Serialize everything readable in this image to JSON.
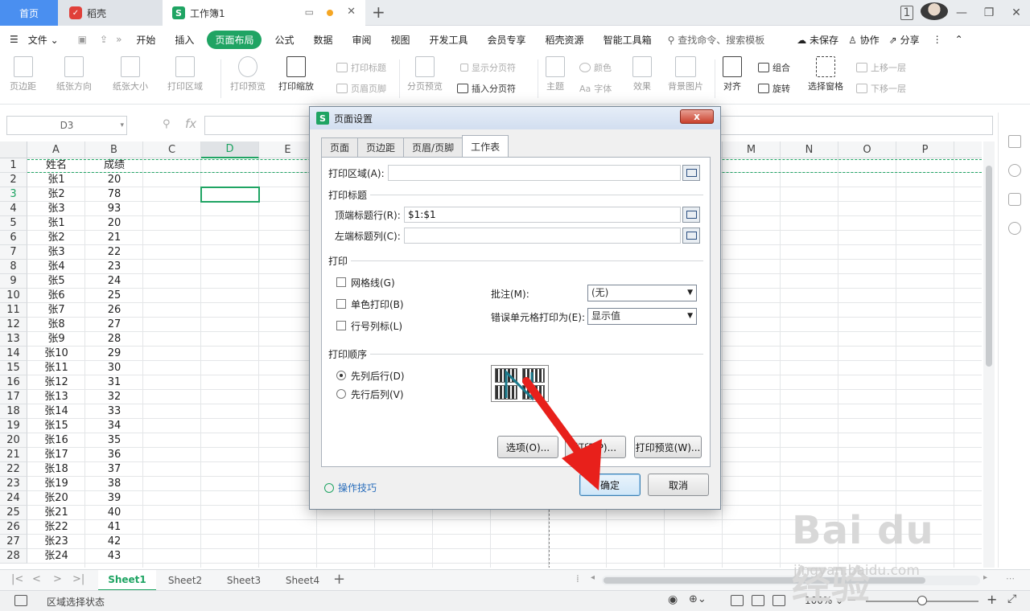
{
  "titlebar": {
    "home_tab": "首页",
    "daoke_tab": "稻壳",
    "workbook_tab": "工作簿1",
    "badge": "1"
  },
  "menubar": {
    "file": "文件",
    "items": [
      "开始",
      "插入",
      "页面布局",
      "公式",
      "数据",
      "审阅",
      "视图",
      "开发工具",
      "会员专享",
      "稻壳资源",
      "智能工具箱"
    ],
    "active": "页面布局",
    "search_placeholder": "查找命令、搜索模板",
    "unsaved": "未保存",
    "collab": "协作",
    "share": "分享"
  },
  "ribbon": {
    "margins": "页边距",
    "orientation": "纸张方向",
    "size": "纸张大小",
    "print_area": "打印区域",
    "print_preview": "打印预览",
    "print_scale": "打印缩放",
    "print_titles": "打印标题",
    "header_footer": "页眉页脚",
    "page_break_preview": "分页预览",
    "show_page_breaks": "显示分页符",
    "insert_page_break": "插入分页符",
    "theme": "主题",
    "colors": "颜色",
    "fonts": "字体",
    "effects": "效果",
    "background": "背景图片",
    "align": "对齐",
    "group": "组合",
    "rotate": "旋转",
    "selection_pane": "选择窗格",
    "bring_forward": "上移一层",
    "send_backward": "下移一层"
  },
  "formulabar": {
    "namebox": "D3",
    "fx": "fx"
  },
  "grid": {
    "columns": [
      "A",
      "B",
      "C",
      "D",
      "E",
      "M",
      "N",
      "O",
      "P"
    ],
    "selected_column": "D",
    "rows": [
      "1",
      "2",
      "3",
      "4",
      "5",
      "6",
      "7",
      "8",
      "9",
      "10",
      "11",
      "12",
      "13",
      "14",
      "15",
      "16",
      "17",
      "18",
      "19",
      "20",
      "21",
      "22",
      "23",
      "24",
      "25",
      "26",
      "27",
      "28"
    ],
    "selected_row": "3",
    "colA": [
      "姓名",
      "张1",
      "张2",
      "张3",
      "张1",
      "张2",
      "张3",
      "张4",
      "张5",
      "张6",
      "张7",
      "张8",
      "张9",
      "张10",
      "张11",
      "张12",
      "张13",
      "张14",
      "张15",
      "张16",
      "张17",
      "张18",
      "张19",
      "张20",
      "张21",
      "张22",
      "张23",
      "张24"
    ],
    "colB": [
      "成绩",
      "20",
      "78",
      "93",
      "20",
      "21",
      "22",
      "23",
      "24",
      "25",
      "26",
      "27",
      "28",
      "29",
      "30",
      "31",
      "32",
      "33",
      "34",
      "35",
      "36",
      "37",
      "38",
      "39",
      "40",
      "41",
      "42",
      "43"
    ]
  },
  "sheets": {
    "tabs": [
      "Sheet1",
      "Sheet2",
      "Sheet3",
      "Sheet4"
    ],
    "active": "Sheet1"
  },
  "status": {
    "mode": "区域选择状态",
    "zoom": "100%"
  },
  "dialog": {
    "title": "页面设置",
    "tabs": [
      "页面",
      "页边距",
      "页眉/页脚",
      "工作表"
    ],
    "active_tab": "工作表",
    "print_area_label": "打印区域(A):",
    "print_area_value": "",
    "print_titles_group": "打印标题",
    "top_rows_label": "顶端标题行(R):",
    "top_rows_value": "$1:$1",
    "left_cols_label": "左端标题列(C):",
    "left_cols_value": "",
    "print_group": "打印",
    "gridlines": "网格线(G)",
    "mono": "单色打印(B)",
    "row_col_headers": "行号列标(L)",
    "comments_label": "批注(M):",
    "comments_value": "(无)",
    "errors_label": "错误单元格打印为(E):",
    "errors_value": "显示值",
    "order_group": "打印顺序",
    "down_then_over": "先列后行(D)",
    "over_then_down": "先行后列(V)",
    "options_btn": "选项(O)...",
    "print_btn": "打印(P)...",
    "preview_btn": "打印预览(W)...",
    "ok_btn": "确定",
    "cancel_btn": "取消",
    "tips": "操作技巧",
    "close": "x"
  },
  "watermark": {
    "main": "Bai du 经验",
    "sub": "jingyan.baidu.com"
  },
  "colors": {
    "accent": "#1fa463",
    "arrow": "#e8201b"
  }
}
